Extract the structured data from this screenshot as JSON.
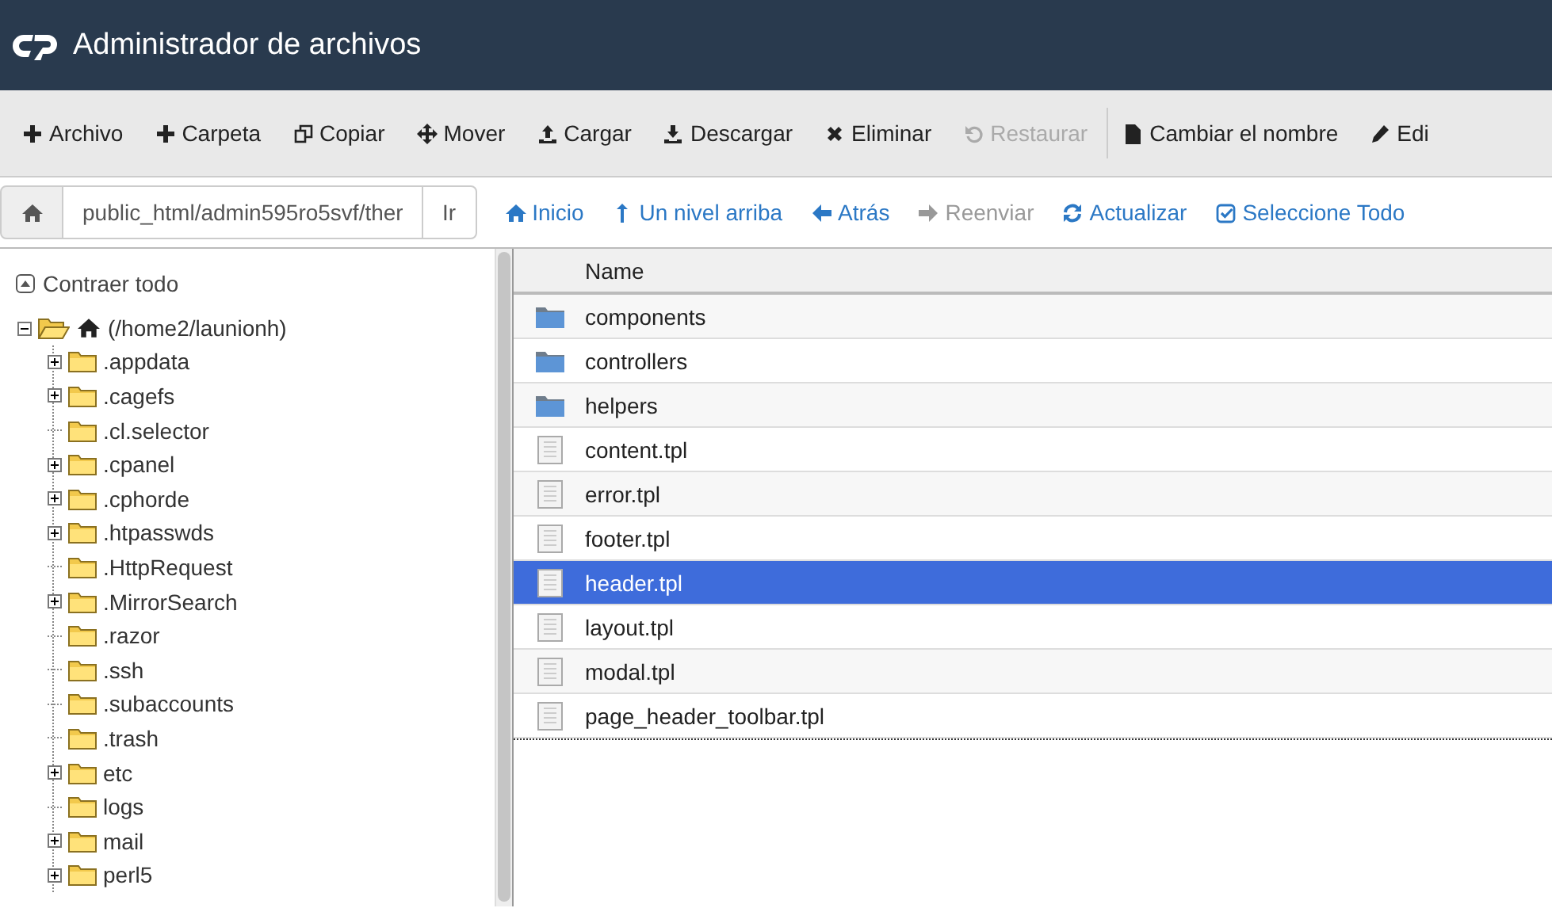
{
  "header": {
    "title": "Administrador de archivos"
  },
  "toolbar": [
    {
      "label": "Archivo",
      "disabled": false
    },
    {
      "label": "Carpeta",
      "disabled": false
    },
    {
      "label": "Copiar",
      "disabled": false
    },
    {
      "label": "Mover",
      "disabled": false
    },
    {
      "label": "Cargar",
      "disabled": false
    },
    {
      "label": "Descargar",
      "disabled": false
    },
    {
      "label": "Eliminar",
      "disabled": false
    },
    {
      "label": "Restaurar",
      "disabled": true
    },
    {
      "label": "Cambiar el nombre",
      "disabled": false
    },
    {
      "label": "Edi",
      "disabled": false
    }
  ],
  "path_bar": {
    "value": "public_html/admin595ro5svf/ther",
    "go": "Ir"
  },
  "nav": [
    {
      "label": "Inicio",
      "disabled": false
    },
    {
      "label": "Un nivel arriba",
      "disabled": false
    },
    {
      "label": "Atrás",
      "disabled": false
    },
    {
      "label": "Reenviar",
      "disabled": true
    },
    {
      "label": "Actualizar",
      "disabled": false
    },
    {
      "label": "Seleccione Todo",
      "disabled": false
    }
  ],
  "tree": {
    "collapse_all": "Contraer todo",
    "root": {
      "label": "(/home2/launionh)",
      "expanded": true,
      "children": [
        {
          "label": ".appdata",
          "expandable": true
        },
        {
          "label": ".cagefs",
          "expandable": true
        },
        {
          "label": ".cl.selector",
          "expandable": false
        },
        {
          "label": ".cpanel",
          "expandable": true
        },
        {
          "label": ".cphorde",
          "expandable": true
        },
        {
          "label": ".htpasswds",
          "expandable": true
        },
        {
          "label": ".HttpRequest",
          "expandable": false
        },
        {
          "label": ".MirrorSearch",
          "expandable": true
        },
        {
          "label": ".razor",
          "expandable": false
        },
        {
          "label": ".ssh",
          "expandable": false
        },
        {
          "label": ".subaccounts",
          "expandable": false
        },
        {
          "label": ".trash",
          "expandable": false
        },
        {
          "label": "etc",
          "expandable": true
        },
        {
          "label": "logs",
          "expandable": false
        },
        {
          "label": "mail",
          "expandable": true
        },
        {
          "label": "perl5",
          "expandable": true
        }
      ]
    }
  },
  "files": {
    "columns": [
      "Name"
    ],
    "rows": [
      {
        "name": "components",
        "kind": "folder",
        "selected": false
      },
      {
        "name": "controllers",
        "kind": "folder",
        "selected": false
      },
      {
        "name": "helpers",
        "kind": "folder",
        "selected": false
      },
      {
        "name": "content.tpl",
        "kind": "file",
        "selected": false
      },
      {
        "name": "error.tpl",
        "kind": "file",
        "selected": false
      },
      {
        "name": "footer.tpl",
        "kind": "file",
        "selected": false
      },
      {
        "name": "header.tpl",
        "kind": "file",
        "selected": true
      },
      {
        "name": "layout.tpl",
        "kind": "file",
        "selected": false
      },
      {
        "name": "modal.tpl",
        "kind": "file",
        "selected": false
      },
      {
        "name": "page_header_toolbar.tpl",
        "kind": "file",
        "selected": false
      }
    ]
  }
}
